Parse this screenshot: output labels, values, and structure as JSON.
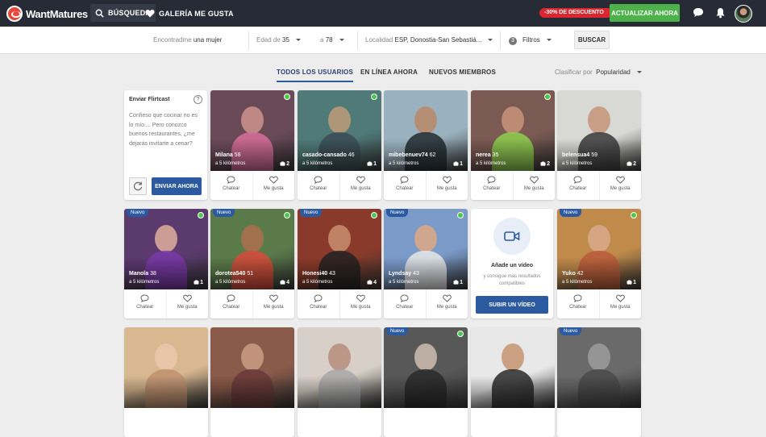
{
  "header": {
    "logo_text": "WantMatures",
    "nav_search": "BÚSQUEDA",
    "nav_gallery": "GALERÍA ME GUSTA",
    "discount": "-30% DE DESCUENTO",
    "upgrade": "ACTUALIZAR AHORA"
  },
  "filters": {
    "looking_label": "Encontradme",
    "looking_value": "una mujer",
    "age_label": "Edad de",
    "age_from": "35",
    "age_to_label": "a",
    "age_to": "78",
    "location_label": "Localidad",
    "location_value": "ESP, Donostia-San Sebastiá...",
    "filters_count": "3",
    "filters_label": "Filtros",
    "search_button": "BUSCAR"
  },
  "tabs": {
    "all": "TODOS LOS USUARIOS",
    "online": "EN LÍNEA AHORA",
    "new": "NUEVOS MIEMBROS",
    "sort_label": "Clasificar por",
    "sort_value": "Popularidad"
  },
  "flirtcast": {
    "title": "Enviar Flirtcast",
    "message": "Confieso que cocinar no es lo mío.... Pero conozco buenos restaurantes, ¿me dejarás invitarte a cenar?",
    "send_button": "ENVIAR AHORA"
  },
  "video_card": {
    "title": "Añade un vídeo",
    "subtitle": "y consigue más resultados compatibles",
    "button": "SUBIR UN VÍDEO"
  },
  "labels": {
    "chat": "Chatear",
    "like": "Me gusta",
    "new_badge": "Nuevo"
  },
  "profiles_row1": [
    {
      "name": "Milana",
      "age": "58",
      "distance": "a 5 kilómetros",
      "photos": "2",
      "online": true,
      "new": false,
      "colors": [
        "#6b4a58",
        "#c98f8a",
        "#d86e9c"
      ]
    },
    {
      "name": "casado-cansado",
      "age": "46",
      "distance": "a 5 kilómetros",
      "photos": "1",
      "online": true,
      "new": false,
      "colors": [
        "#4f7a78",
        "#b89a78",
        "#3a4b55"
      ]
    },
    {
      "name": "mibebenuev74",
      "age": "62",
      "distance": "a 5 kilómetros",
      "photos": "1",
      "online": false,
      "new": false,
      "colors": [
        "#9ab2c0",
        "#b88a6e",
        "#222a30"
      ]
    },
    {
      "name": "nerea",
      "age": "35",
      "distance": "a 5 kilómetros",
      "photos": "2",
      "online": true,
      "new": false,
      "colors": [
        "#7a5a52",
        "#c49078",
        "#8ed04e"
      ]
    },
    {
      "name": "belensua4",
      "age": "59",
      "distance": "a 5 kilómetros",
      "photos": "2",
      "online": false,
      "new": false,
      "colors": [
        "#d8d8d4",
        "#c8987e",
        "#3a3a3a"
      ]
    }
  ],
  "profiles_row2": [
    {
      "name": "Manola",
      "age": "38",
      "distance": "a 5 kilómetros",
      "photos": "1",
      "online": true,
      "new": true,
      "colors": [
        "#5b3a6e",
        "#d8a898",
        "#7a3aa8"
      ]
    },
    {
      "name": "dorotea540",
      "age": "51",
      "distance": "a 5 kilómetros",
      "photos": "4",
      "online": true,
      "new": true,
      "colors": [
        "#5a7a4a",
        "#a8704e",
        "#d84a3a"
      ]
    },
    {
      "name": "Honesi40",
      "age": "43",
      "distance": "a 5 kilómetros",
      "photos": "4",
      "online": true,
      "new": true,
      "colors": [
        "#8a3a2a",
        "#c48a6a",
        "#222222"
      ]
    },
    {
      "name": "Lyndsay",
      "age": "43",
      "distance": "a 5 kilómetros",
      "photos": "1",
      "online": true,
      "new": true,
      "colors": [
        "#7a9ac8",
        "#d8a888",
        "#e8e8e8"
      ]
    },
    {
      "name": "Yuko",
      "age": "42",
      "distance": "a 5 kilómetros",
      "photos": "1",
      "online": true,
      "new": true,
      "colors": [
        "#c08a4a",
        "#d8a888",
        "#b85a3a"
      ]
    }
  ],
  "profiles_row3": [
    {
      "new": false,
      "online": false,
      "colors": [
        "#d8b890",
        "#e8c8a8",
        "#c09070"
      ]
    },
    {
      "new": false,
      "online": false,
      "colors": [
        "#8a5a4a",
        "#c89880",
        "#6a3a3a"
      ]
    },
    {
      "new": false,
      "online": false,
      "colors": [
        "#d8d0c8",
        "#b89080",
        "#a8a8a8"
      ]
    },
    {
      "new": true,
      "online": true,
      "colors": [
        "#585858",
        "#c8b8a8",
        "#2a2a2a"
      ]
    },
    {
      "new": false,
      "online": false,
      "colors": [
        "#e8e8e8",
        "#c89878",
        "#2a2a2a"
      ]
    },
    {
      "new": true,
      "online": false,
      "colors": [
        "#6a6a6a",
        "#9a9a9a",
        "#4a4a4a"
      ]
    }
  ]
}
